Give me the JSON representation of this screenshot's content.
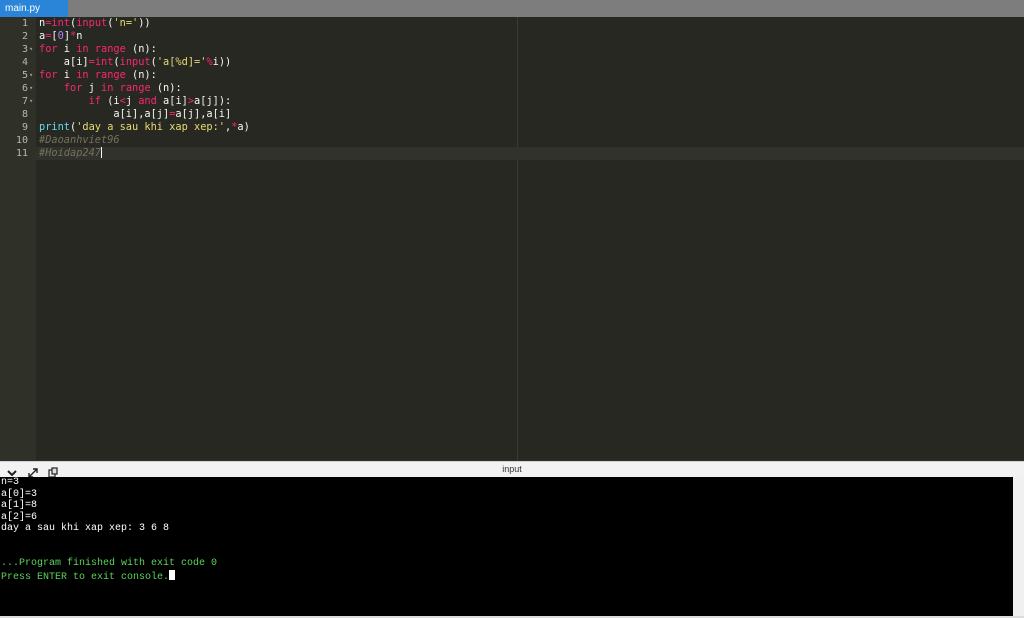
{
  "tabs": [
    {
      "label": "main.py"
    }
  ],
  "editor": {
    "line_numbers": [
      "1",
      "2",
      "3",
      "4",
      "5",
      "6",
      "7",
      "8",
      "9",
      "10",
      "11"
    ],
    "fold_marks": [
      "",
      "",
      "▾",
      "",
      "▾",
      "▾",
      "▾",
      "",
      "",
      "",
      ""
    ],
    "lines": [
      [
        {
          "t": "n",
          "c": ""
        },
        {
          "t": "=",
          "c": "kw"
        },
        {
          "t": "int",
          "c": "kw"
        },
        {
          "t": "(",
          "c": ""
        },
        {
          "t": "input",
          "c": "kw"
        },
        {
          "t": "(",
          "c": ""
        },
        {
          "t": "'n='",
          "c": "str"
        },
        {
          "t": "))",
          "c": ""
        }
      ],
      [
        {
          "t": "a",
          "c": ""
        },
        {
          "t": "=",
          "c": "kw"
        },
        {
          "t": "[",
          "c": ""
        },
        {
          "t": "0",
          "c": "num"
        },
        {
          "t": "]",
          "c": ""
        },
        {
          "t": "*",
          "c": "kw"
        },
        {
          "t": "n",
          "c": ""
        }
      ],
      [
        {
          "t": "for",
          "c": "kw"
        },
        {
          "t": " i ",
          "c": ""
        },
        {
          "t": "in",
          "c": "kw"
        },
        {
          "t": " ",
          "c": ""
        },
        {
          "t": "range",
          "c": "kw"
        },
        {
          "t": " (n):",
          "c": ""
        }
      ],
      [
        {
          "t": "    a[i]",
          "c": ""
        },
        {
          "t": "=",
          "c": "kw"
        },
        {
          "t": "int",
          "c": "kw"
        },
        {
          "t": "(",
          "c": ""
        },
        {
          "t": "input",
          "c": "kw"
        },
        {
          "t": "(",
          "c": ""
        },
        {
          "t": "'a[%d]='",
          "c": "str"
        },
        {
          "t": "%",
          "c": "kw"
        },
        {
          "t": "i))",
          "c": ""
        }
      ],
      [
        {
          "t": "for",
          "c": "kw"
        },
        {
          "t": " i ",
          "c": ""
        },
        {
          "t": "in",
          "c": "kw"
        },
        {
          "t": " ",
          "c": ""
        },
        {
          "t": "range",
          "c": "kw"
        },
        {
          "t": " (n):",
          "c": ""
        }
      ],
      [
        {
          "t": "    ",
          "c": ""
        },
        {
          "t": "for",
          "c": "kw"
        },
        {
          "t": " j ",
          "c": ""
        },
        {
          "t": "in",
          "c": "kw"
        },
        {
          "t": " ",
          "c": ""
        },
        {
          "t": "range",
          "c": "kw"
        },
        {
          "t": " (n):",
          "c": ""
        }
      ],
      [
        {
          "t": "        ",
          "c": ""
        },
        {
          "t": "if",
          "c": "kw"
        },
        {
          "t": " (i",
          "c": ""
        },
        {
          "t": "<",
          "c": "kw"
        },
        {
          "t": "j ",
          "c": ""
        },
        {
          "t": "and",
          "c": "kw"
        },
        {
          "t": " a[i]",
          "c": ""
        },
        {
          "t": ">",
          "c": "kw"
        },
        {
          "t": "a[j]):",
          "c": ""
        }
      ],
      [
        {
          "t": "            a[i],a[j]",
          "c": ""
        },
        {
          "t": "=",
          "c": "kw"
        },
        {
          "t": "a[j],a[i]",
          "c": ""
        }
      ],
      [
        {
          "t": "print",
          "c": "fn"
        },
        {
          "t": "(",
          "c": ""
        },
        {
          "t": "'day a sau khi xap xep:'",
          "c": "str"
        },
        {
          "t": ",",
          "c": ""
        },
        {
          "t": "*",
          "c": "kw"
        },
        {
          "t": "a)",
          "c": ""
        }
      ],
      [
        {
          "t": "#Daoanhviet96",
          "c": "cmt"
        }
      ],
      [
        {
          "t": "#Hoidap247",
          "c": "cmt"
        }
      ]
    ]
  },
  "console": {
    "title": "input",
    "controls": [
      "chevron-down-icon",
      "expand-icon",
      "copy-icon"
    ],
    "output_lines": [
      {
        "text": "n=3",
        "color": "white"
      },
      {
        "text": "a[0]=3",
        "color": "white"
      },
      {
        "text": "a[1]=8",
        "color": "white"
      },
      {
        "text": "a[2]=6",
        "color": "white"
      },
      {
        "text": "day a sau khi xap xep: 3 6 8",
        "color": "white"
      },
      {
        "text": "",
        "color": "white"
      },
      {
        "text": "",
        "color": "white"
      },
      {
        "text": "...Program finished with exit code 0",
        "color": "green"
      },
      {
        "text": "Press ENTER to exit console.",
        "color": "green"
      }
    ]
  }
}
